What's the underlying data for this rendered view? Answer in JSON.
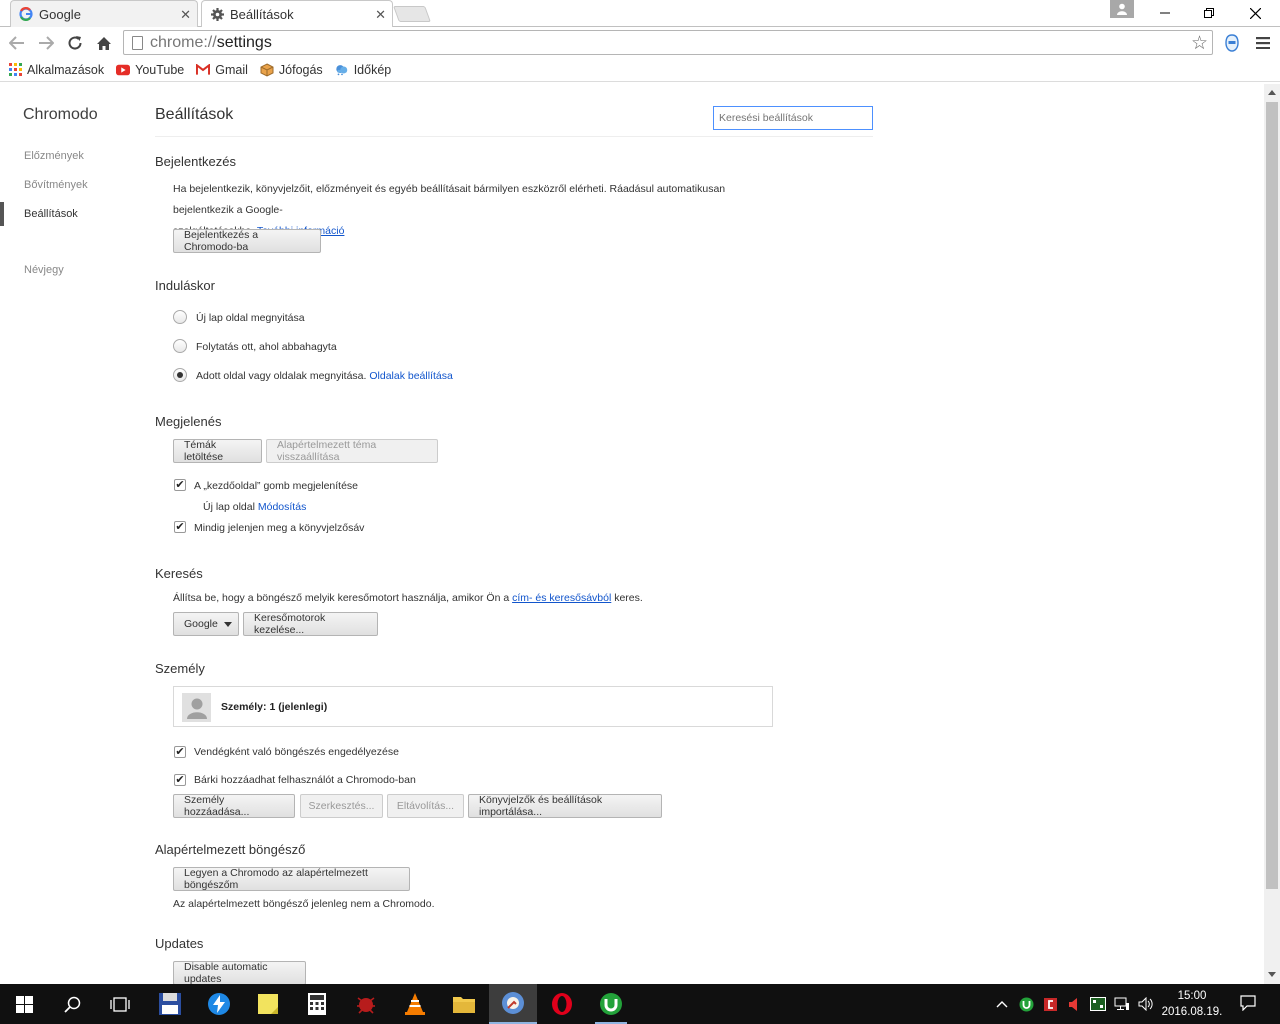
{
  "tabs": [
    {
      "title": "Google",
      "icon": "google-icon"
    },
    {
      "title": "Beállítások",
      "icon": "gear-icon"
    }
  ],
  "toolbar": {
    "url_scheme": "chrome://",
    "url_path": "settings"
  },
  "bookmarks": [
    {
      "label": "Alkalmazások",
      "icon": "apps-grid-icon"
    },
    {
      "label": "YouTube",
      "icon": "youtube-icon"
    },
    {
      "label": "Gmail",
      "icon": "gmail-icon"
    },
    {
      "label": "Jófogás",
      "icon": "jofogas-icon"
    },
    {
      "label": "Időkép",
      "icon": "weather-icon"
    }
  ],
  "sidebar": {
    "brand": "Chromodo",
    "items": [
      {
        "label": "Előzmények"
      },
      {
        "label": "Bővítmények"
      },
      {
        "label": "Beállítások"
      },
      {
        "label": "Névjegy"
      }
    ]
  },
  "main": {
    "title": "Beállítások",
    "search_placeholder": "Keresési beállítások",
    "signin": {
      "title": "Bejelentkezés",
      "text_line1": "Ha bejelentkezik, könyvjelzőit, előzményeit és egyéb beállításait bármilyen eszközről elérheti. Ráadásul automatikusan bejelentkezik a Google-",
      "text_line2": "szolgáltatásokba.",
      "more_link": "További információ",
      "button": "Bejelentkezés a Chromodo-ba"
    },
    "startup": {
      "title": "Induláskor",
      "options": [
        {
          "label": "Új lap oldal megnyitása",
          "checked": false
        },
        {
          "label": "Folytatás ott, ahol abbahagyta",
          "checked": false
        },
        {
          "label": "Adott oldal vagy oldalak megnyitása.",
          "checked": true
        }
      ],
      "pages_link": "Oldalak beállítása"
    },
    "appearance": {
      "title": "Megjelenés",
      "get_themes": "Témák letöltése",
      "reset_theme": "Alapértelmezett téma visszaállítása",
      "show_home": "A „kezdőoldal” gomb megjelenítése",
      "home_sub": "Új lap oldal",
      "home_change": "Módosítás",
      "show_bookmarks": "Mindig jelenjen meg a könyvjelzősáv"
    },
    "search": {
      "title": "Keresés",
      "text_before": "Állítsa be, hogy a böngésző melyik keresőmotort használja, amikor Ön a",
      "link": "cím- és keresősávból",
      "text_after": "keres.",
      "engine": "Google",
      "manage": "Keresőmotorok kezelése..."
    },
    "people": {
      "title": "Személy",
      "profile": "Személy: 1 (jelenlegi)",
      "guest": "Vendégként való böngészés engedélyezése",
      "anyone": "Bárki hozzáadhat felhasználót a Chromodo-ban",
      "add": "Személy hozzáadása...",
      "edit": "Szerkesztés...",
      "remove": "Eltávolítás...",
      "import": "Könyvjelzők és beállítások importálása..."
    },
    "default_browser": {
      "title": "Alapértelmezett böngésző",
      "button": "Legyen a Chromodo az alapértelmezett böngészőm",
      "status": "Az alapértelmezett böngésző jelenleg nem a Chromodo."
    },
    "updates": {
      "title": "Updates",
      "button": "Disable automatic updates"
    }
  },
  "taskbar": {
    "time": "15:00",
    "date": "2016.08.19."
  }
}
